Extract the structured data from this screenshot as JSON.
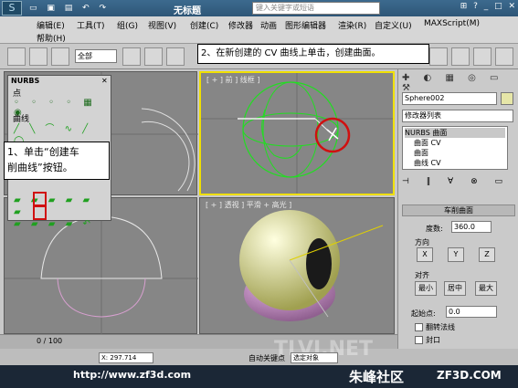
{
  "window": {
    "title": "无标题",
    "search_placeholder": "键入关键字或短语"
  },
  "menu": [
    "编辑(E)",
    "工具(T)",
    "组(G)",
    "视图(V)",
    "创建(C)",
    "修改器",
    "动画",
    "图形编辑器",
    "渲染(R)",
    "自定义(U)",
    "MAXScript(M)",
    "帮助(H)"
  ],
  "toolbar": {
    "selection_filter": "全部"
  },
  "nurbs_panel": {
    "title": "NURBS",
    "group_point": "点",
    "group_curve": "曲线"
  },
  "viewports": {
    "top_left": "",
    "top_right": "[ + ] 前 ] 线框 ]",
    "bottom_left": "",
    "bottom_right": "[ + ] 透视 ] 平滑 + 高光 ]"
  },
  "callouts": {
    "step1_line1": "1、单击“创建车",
    "step1_line2": "削曲线”按钮。",
    "step2": "2、在新创建的 CV 曲线上单击，创建曲面。"
  },
  "command_panel": {
    "object_name": "Sphere002",
    "modifier_list": "修改器列表",
    "stack": [
      "NURBS 曲面",
      "曲面 CV",
      "曲面",
      "曲线 CV"
    ],
    "rollout_title": "车削曲面",
    "degrees_label": "度数:",
    "degrees_value": "360.0",
    "direction_label": "方向",
    "dir_x": "X",
    "dir_y": "Y",
    "dir_z": "Z",
    "align_label": "对齐",
    "align_min": "最小",
    "align_center": "居中",
    "align_max": "最大",
    "start_point_label": "起始点:",
    "start_point_value": "0.0",
    "flip_normals": "翻转法线",
    "cap": "封口"
  },
  "status": {
    "timeline": "0 / 100",
    "coord_x": "X: 297.714",
    "auto_key": "自动关键点",
    "set_key": "选定对象",
    "url": "http://www.zf3d.com",
    "brand": "朱峰社区",
    "brand_domain": "ZF3D.COM",
    "watermark": "TLVI.NET"
  },
  "colors": {
    "accent": "#2e5677",
    "highlight_red": "#d01010",
    "curve_green": "#22dd22",
    "sphere": "#e8e8a0",
    "cap": "#d8a0d0"
  }
}
